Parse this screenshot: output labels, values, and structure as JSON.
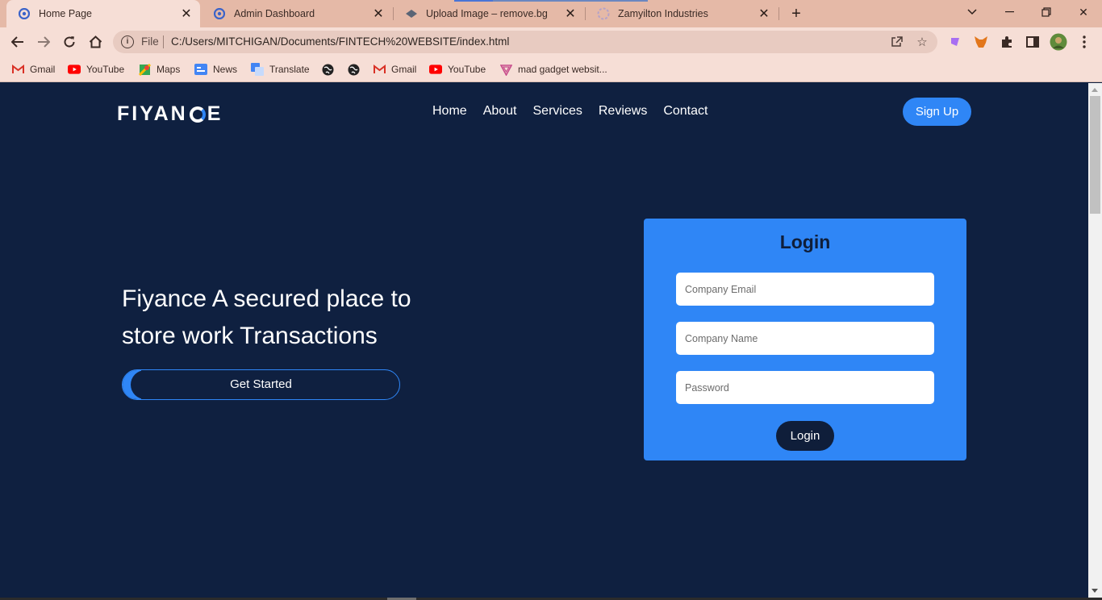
{
  "browser": {
    "tabs": [
      {
        "title": "Home Page",
        "active": true,
        "icon": "chrome-page-icon"
      },
      {
        "title": "Admin Dashboard",
        "active": false,
        "icon": "chrome-page-icon"
      },
      {
        "title": "Upload Image – remove.bg",
        "active": false,
        "icon": "removebg-icon"
      },
      {
        "title": "Zamyilton Industries",
        "active": false,
        "icon": "zamyilton-icon"
      }
    ],
    "address": {
      "scheme_label": "File",
      "url": "C:/Users/MITCHIGAN/Documents/FINTECH%20WEBSITE/index.html"
    },
    "bookmarks": [
      {
        "label": "Gmail",
        "icon": "gmail-icon"
      },
      {
        "label": "YouTube",
        "icon": "youtube-icon"
      },
      {
        "label": "Maps",
        "icon": "maps-icon"
      },
      {
        "label": "News",
        "icon": "news-icon"
      },
      {
        "label": "Translate",
        "icon": "translate-icon"
      },
      {
        "label": "",
        "icon": "globe-icon"
      },
      {
        "label": "",
        "icon": "globe-icon"
      },
      {
        "label": "Gmail",
        "icon": "gmail-icon"
      },
      {
        "label": "YouTube",
        "icon": "youtube-icon"
      },
      {
        "label": "mad gadget websit...",
        "icon": "mad-gadget-icon"
      }
    ]
  },
  "site": {
    "logo": {
      "pre": "FIYAN",
      "post": "E"
    },
    "nav": [
      "Home",
      "About",
      "Services",
      "Reviews",
      "Contact"
    ],
    "signup_label": "Sign Up",
    "hero": {
      "title": "Fiyance A secured place to store work Transactions",
      "cta_label": "Get Started"
    },
    "login": {
      "title": "Login",
      "email_placeholder": "Company Email",
      "company_placeholder": "Company Name",
      "password_placeholder": "Password",
      "submit_label": "Login"
    }
  },
  "colors": {
    "page_bg": "#0f2040",
    "accent": "#2f86f6",
    "tab_strip": "#e5b9a7",
    "toolbar": "#f6ded6"
  }
}
